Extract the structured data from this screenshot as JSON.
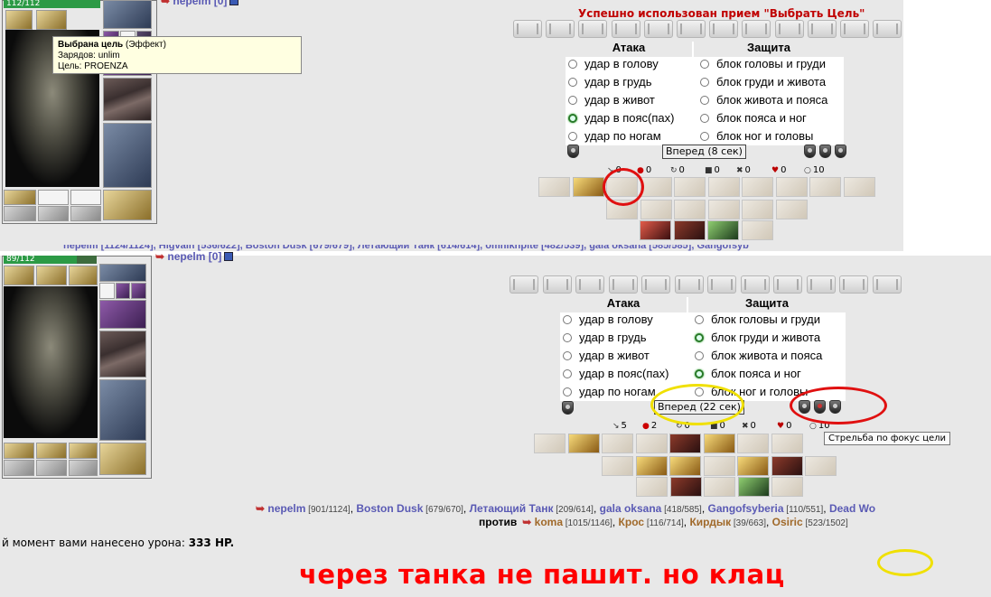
{
  "top": {
    "hp": "112/112",
    "hp_fraction": 1.0,
    "header_name": "nepelm [0]",
    "status_message": "Успешно использован прием \"Выбрать Цель\"",
    "tooltip": {
      "title": "Выбрана цель",
      "type": "(Эффект)",
      "charges": "Зарядов: unlim",
      "target": "Цель: PROENZA"
    },
    "attack_header": "Атака",
    "defense_header": "Защита",
    "attack_options": [
      {
        "label": "удар в голову",
        "selected": false
      },
      {
        "label": "удар в грудь",
        "selected": false
      },
      {
        "label": "удар в живот",
        "selected": false
      },
      {
        "label": "удар в пояс(пах)",
        "selected": true
      },
      {
        "label": "удар по ногам",
        "selected": false
      }
    ],
    "defense_options": [
      {
        "label": "блок головы и груди",
        "selected": false
      },
      {
        "label": "блок груди и живота",
        "selected": false
      },
      {
        "label": "блок живота и пояса",
        "selected": false
      },
      {
        "label": "блок пояса и ног",
        "selected": false
      },
      {
        "label": "блок ног и головы",
        "selected": false
      }
    ],
    "forward_button": "Вперед (8 сек)",
    "counters": [
      "0",
      "0",
      "0",
      "0",
      "0",
      "0",
      "10"
    ],
    "partial_line": "nepelm [1124/1124], Higvain [536/622], Boston Dusk [679/679], Летающий Танк [614/614], omnikhpite [482/539], gala oksana [585/585], Gangofsyb"
  },
  "bottom": {
    "hp": "89/112",
    "hp_fraction": 0.79,
    "header_name": "nepelm [0]",
    "attack_header": "Атака",
    "defense_header": "Защита",
    "attack_options": [
      {
        "label": "удар в голову",
        "selected": false
      },
      {
        "label": "удар в грудь",
        "selected": false
      },
      {
        "label": "удар в живот",
        "selected": false
      },
      {
        "label": "удар в пояс(пах)",
        "selected": false
      },
      {
        "label": "удар по ногам",
        "selected": false
      }
    ],
    "defense_options": [
      {
        "label": "блок головы и груди",
        "selected": false
      },
      {
        "label": "блок груди и живота",
        "selected": true
      },
      {
        "label": "блок живота и пояса",
        "selected": false
      },
      {
        "label": "блок пояса и ног",
        "selected": true
      },
      {
        "label": "блок ног и головы",
        "selected": false
      }
    ],
    "forward_button": "Вперед (22 сек)",
    "counters": [
      "5",
      "2",
      "0",
      "0",
      "0",
      "0",
      "10"
    ],
    "focus_tooltip": "Стрельба по фокус цели",
    "team_line": {
      "names": [
        {
          "name": "nepelm",
          "stats": "[901/1124]"
        },
        {
          "name": "Boston Dusk",
          "stats": "[679/670]"
        },
        {
          "name": "Летающий Танк",
          "stats": "[209/614]"
        },
        {
          "name": "gala oksana",
          "stats": "[418/585]"
        },
        {
          "name": "Gangofsyberia",
          "stats": "[110/551]"
        },
        {
          "name": "Dead Wo",
          "stats": ""
        }
      ]
    },
    "versus_label": "против",
    "enemy_line": {
      "names": [
        {
          "name": "koma",
          "stats": "[1015/1146]"
        },
        {
          "name": "Крос",
          "stats": "[116/714]"
        },
        {
          "name": "Кирдык",
          "stats": "[39/663]"
        },
        {
          "name": "Osiric",
          "stats": "[523/1502]"
        }
      ]
    },
    "damage_prefix": "й момент вами нанесено урона:",
    "damage_value": "333 HP."
  },
  "caption": "через танка не пашит. но клац",
  "colors": {
    "annotation_red": "#e01010",
    "annotation_yellow": "#f0e000",
    "status_red": "#c00000",
    "link_blue": "#5a5ab4",
    "enemy_brown": "#a0692a"
  }
}
